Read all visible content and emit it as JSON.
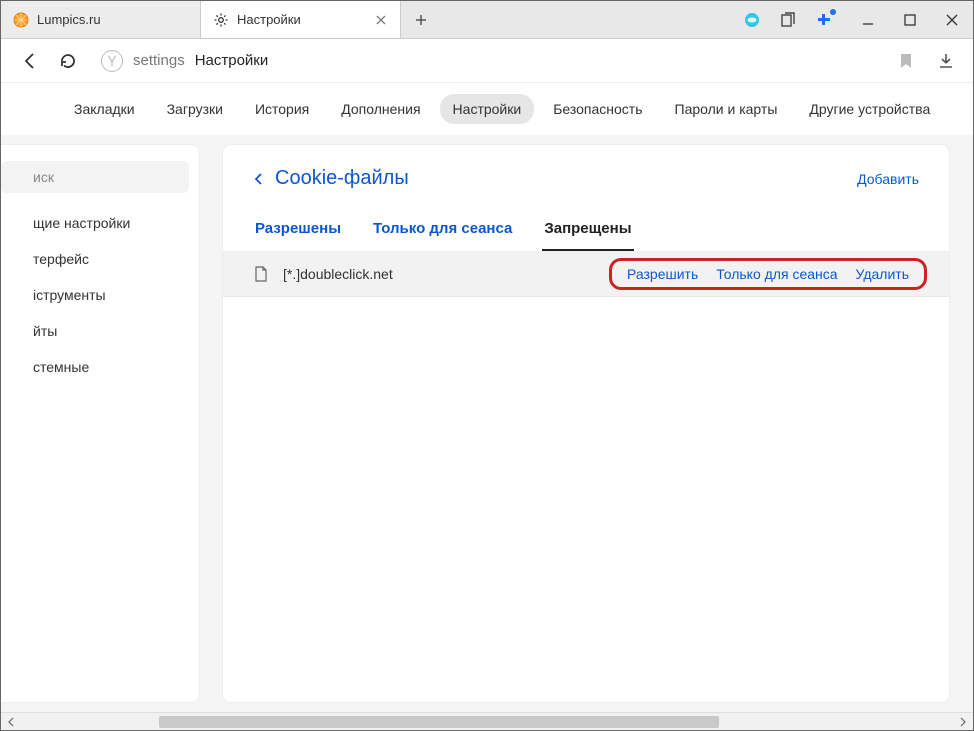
{
  "tabs": [
    {
      "title": "Lumpics.ru",
      "favicon": "orange"
    },
    {
      "title": "Настройки",
      "favicon": "gear"
    }
  ],
  "omnibox": {
    "prefix": "settings",
    "title": "Настройки"
  },
  "topnav": {
    "items": [
      "Закладки",
      "Загрузки",
      "История",
      "Дополнения",
      "Настройки",
      "Безопасность",
      "Пароли и карты",
      "Другие устройства"
    ],
    "active_index": 4
  },
  "sidebar": {
    "search_placeholder": "иск",
    "items": [
      "щие настройки",
      "терфейс",
      "іструменты",
      "йты",
      "стемные"
    ]
  },
  "content": {
    "title": "Cookie-файлы",
    "add_label": "Добавить",
    "subtabs": [
      "Разрешены",
      "Только для сеанса",
      "Запрещены"
    ],
    "active_subtab_index": 2,
    "rows": [
      {
        "domain": "[*.]doubleclick.net",
        "actions": [
          "Разрешить",
          "Только для сеанса",
          "Удалить"
        ]
      }
    ]
  }
}
